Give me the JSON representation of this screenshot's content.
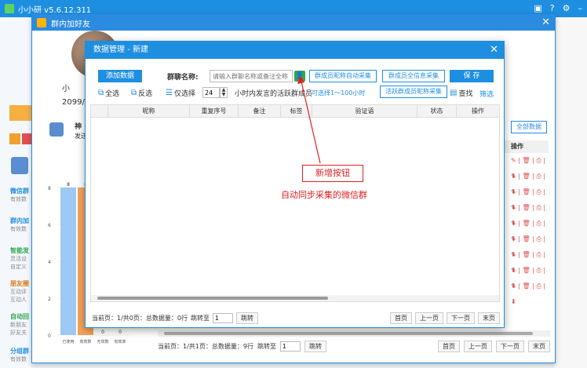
{
  "app": {
    "title": "小小研 v5.6.12.311"
  },
  "outer": {
    "title": "群内加好友",
    "left_name": "小",
    "left_date": "2099/",
    "panel_label": "神",
    "panel_sub": "发送",
    "all_data_btn": "全部数据",
    "op_header": "操作",
    "op_row_icons": "✎ | 🗑 | ⎙ | ⬇",
    "pager": {
      "info": "当前页：1/共1页：总数据量：9行",
      "jump_label": "跳转至",
      "jump_value": "1",
      "jump_btn": "跳转",
      "first": "首页",
      "prev": "上一页",
      "next": "下一页",
      "last": "末页"
    },
    "bar_chart": {
      "y_ticks": [
        "8",
        "6",
        "4",
        "2",
        "0"
      ],
      "bars": [
        {
          "label": "已使用",
          "value": 8,
          "color": "#9ec9f5"
        },
        {
          "label": "有效数",
          "value": 8,
          "color": "#f5a35b"
        },
        {
          "label": "无效数",
          "value": 0,
          "color": "#9ec9f5"
        },
        {
          "label": "有效率",
          "value": 0,
          "color": "#f5a35b"
        }
      ],
      "top_labels": [
        "8",
        "8"
      ]
    },
    "sidebar": [
      "微信群",
      "有效数",
      "群内加",
      "有效数",
      "智能发",
      "灵活设",
      "自定义",
      "朋友圈",
      "互动评",
      "互动人",
      "自动回",
      "新朋友",
      "好友关",
      "分组群",
      "有效数"
    ]
  },
  "modal": {
    "title": "数据管理 - 新建",
    "add_data_btn": "添加数据",
    "group_name_label": "群聊名称:",
    "group_name_placeholder": "请输入群聊名称或备注全称",
    "collect_auto_btn": "群成员昵称自动采集",
    "collect_full_btn": "群成员全信息采集",
    "save_btn": "保 存",
    "select_all": "全选",
    "invert": "反选",
    "only_select": "仅选择",
    "hours_value": "24",
    "hours_text": "小时内发言的活跃群成员",
    "hours_hint": "可选择1～100小时",
    "collect_active_btn": "活跃群成员昵称采集",
    "find": "查找",
    "filter": "筛选",
    "columns": [
      "",
      "昵称",
      "重复序号",
      "备注",
      "标签",
      "验证语",
      "状态",
      "操作"
    ],
    "pager": {
      "info": "当前页：1/共0页：总数据量：0行",
      "jump_label": "跳转至",
      "jump_value": "1",
      "jump_btn": "跳转",
      "first": "首页",
      "prev": "上一页",
      "next": "下一页",
      "last": "末页"
    }
  },
  "annotation": {
    "box_text": "新增按钮",
    "caption": "自动同步采集的微信群",
    "color": "#e02020"
  }
}
